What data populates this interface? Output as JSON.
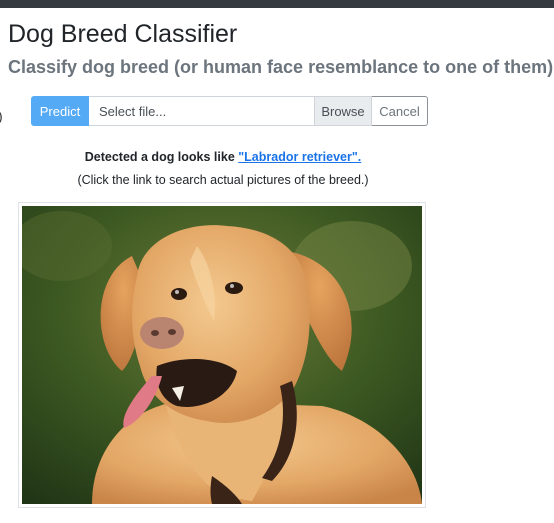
{
  "page": {
    "title": "Dog Breed Classifier",
    "subtitle": "Classify dog breed (or human face resemblance to one of them)"
  },
  "upload": {
    "predict_label": "Predict",
    "file_placeholder": "Select file...",
    "browse_label": "Browse",
    "cancel_label": "Cancel"
  },
  "result": {
    "lead_text": "Detected a dog looks like ",
    "breed_link": "\"Labrador retriever\".",
    "hint": "(Click the link to search actual pictures of the breed.)"
  },
  "colors": {
    "predict_bg": "#55aaf5",
    "link": "#1a73e8",
    "top_bar": "#343a40"
  },
  "image": {
    "subject": "labrador-retriever-photo"
  }
}
